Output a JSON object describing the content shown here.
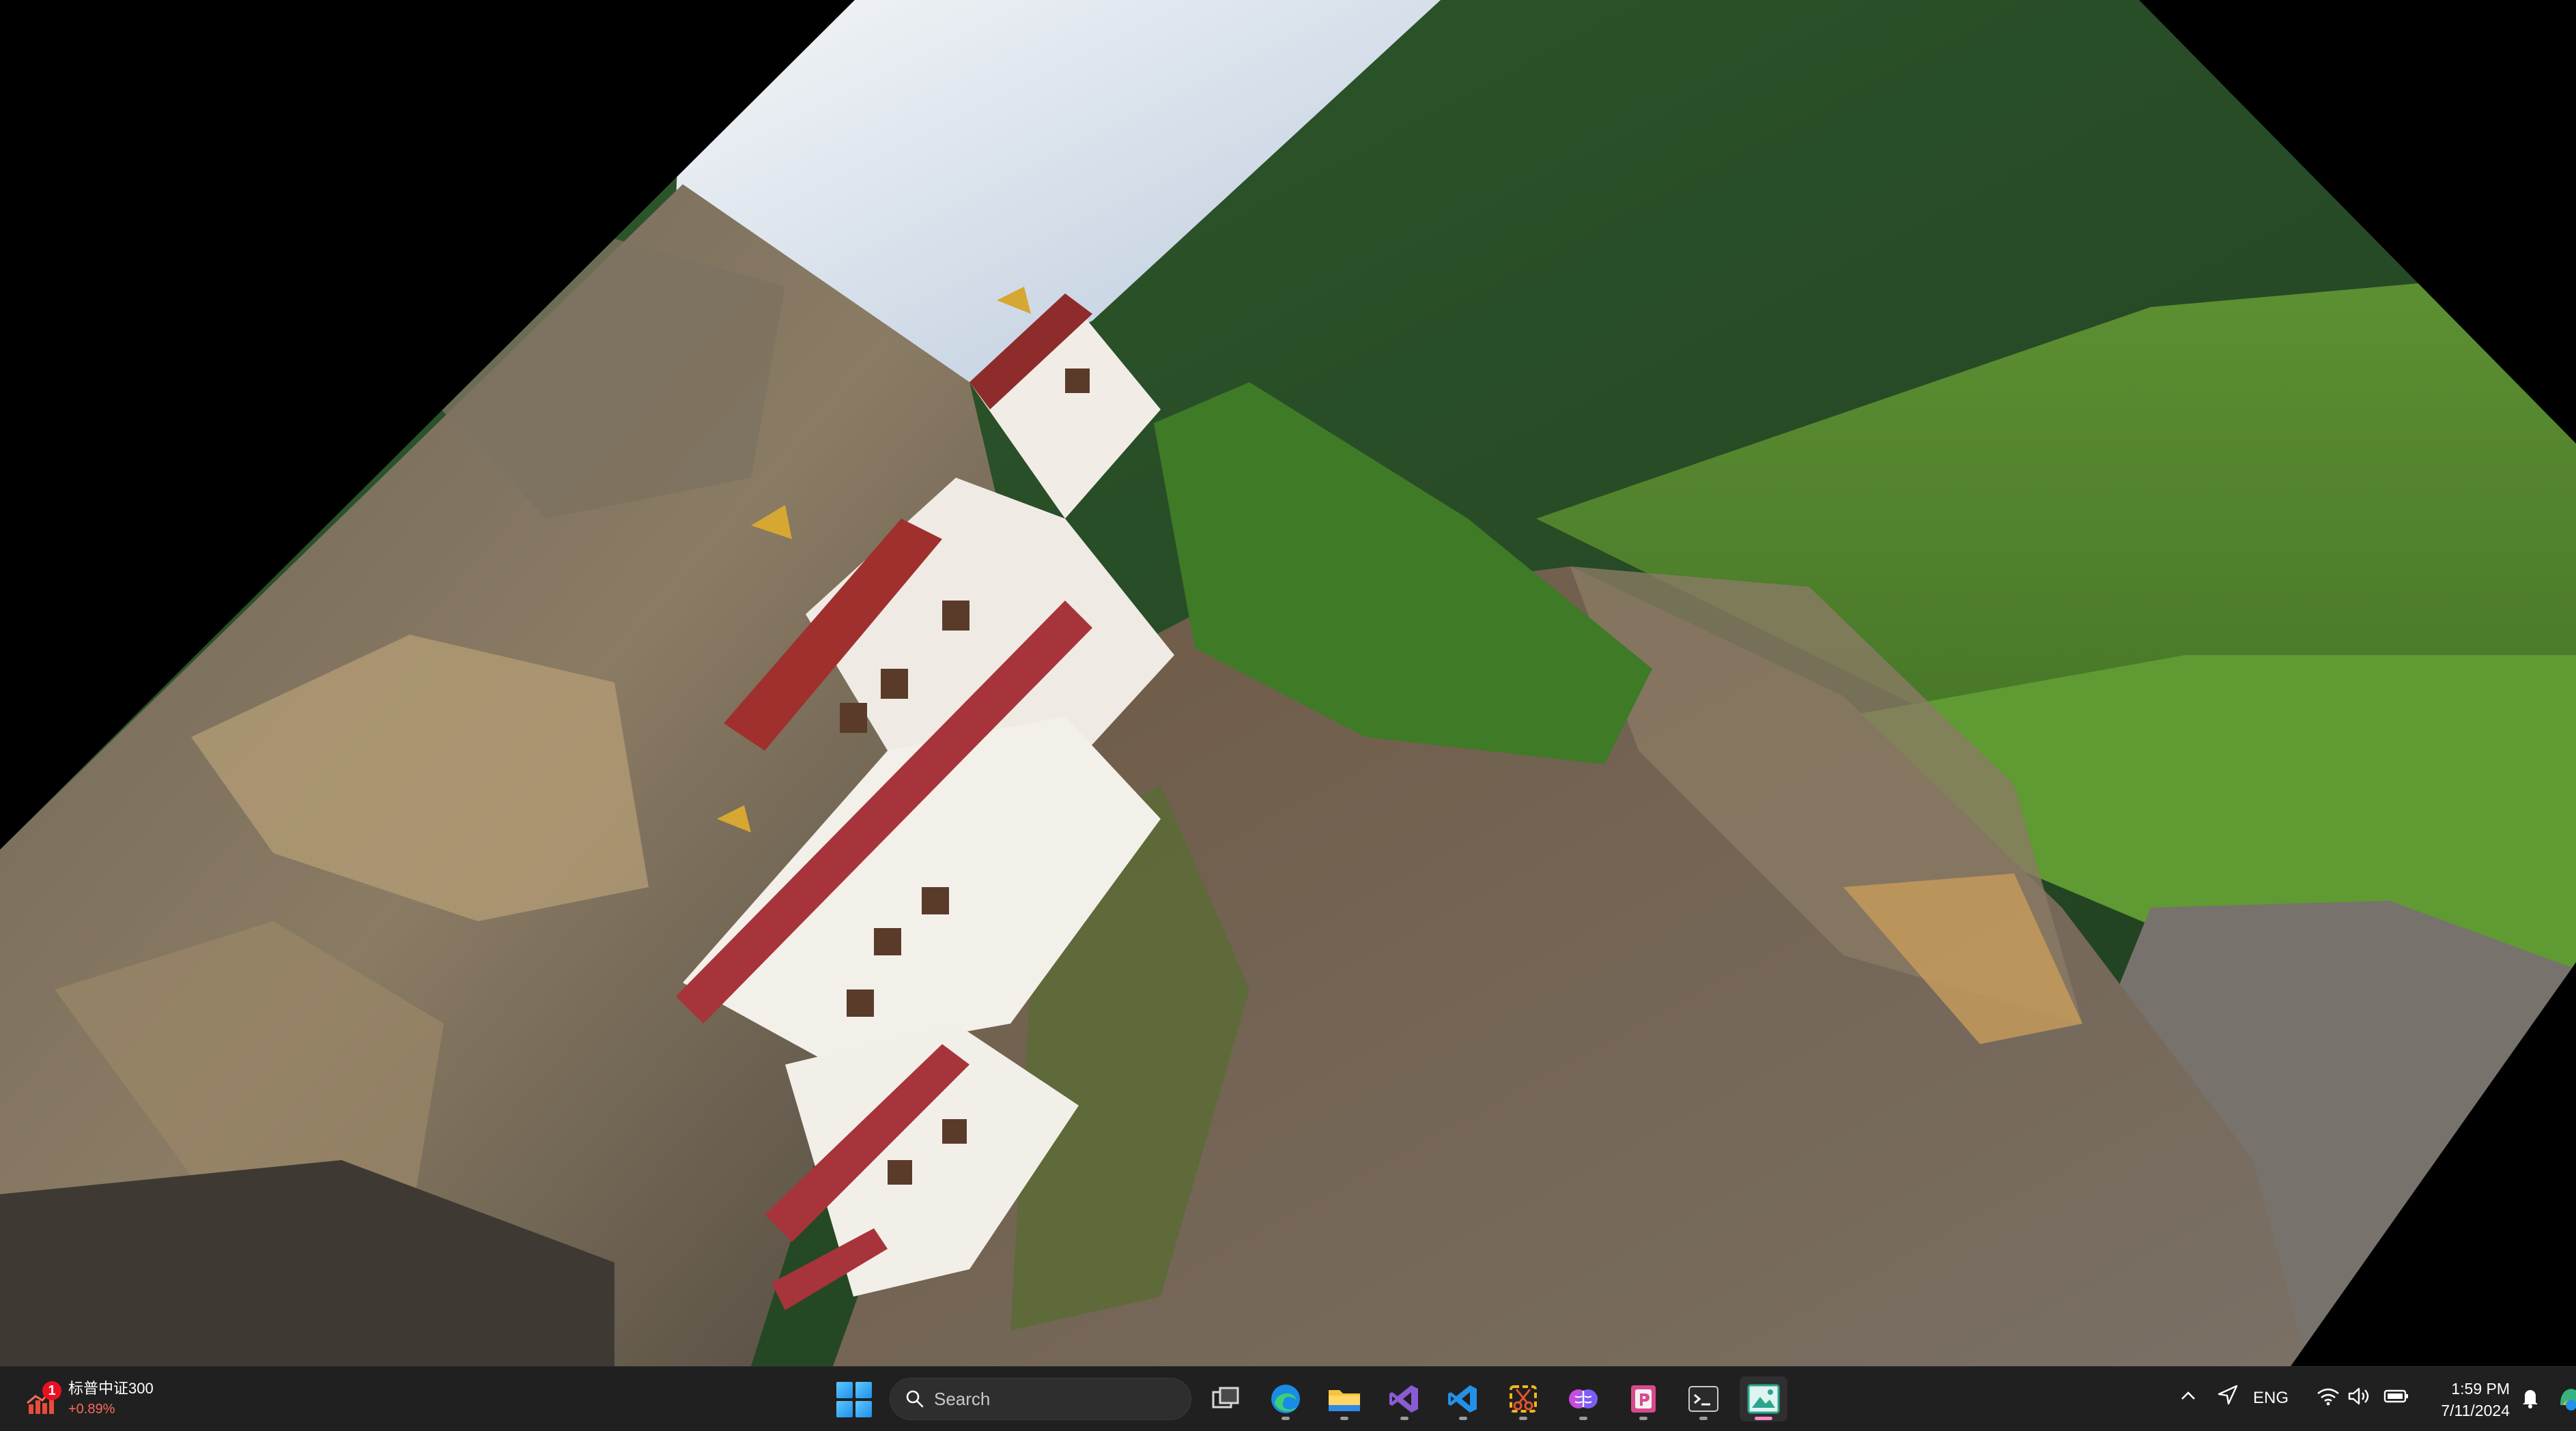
{
  "desktop": {
    "wallpaper": "Rotated photo of a cliffside monastery with forested mountains",
    "icons": []
  },
  "taskbar": {
    "widget": {
      "badge": "1",
      "title": "标普中证300",
      "change": "+0.89%",
      "icon": "stock-chart-icon",
      "change_color": "#ff6a5a"
    },
    "search": {
      "placeholder": "Search"
    },
    "apps": [
      {
        "name": "task-view",
        "icon": "task-view-icon",
        "running": false
      },
      {
        "name": "edge",
        "icon": "edge-icon",
        "running": true
      },
      {
        "name": "file-explorer",
        "icon": "folder-icon",
        "running": true
      },
      {
        "name": "visual-studio",
        "icon": "visual-studio-icon",
        "running": true
      },
      {
        "name": "vs-code",
        "icon": "vscode-icon",
        "running": true
      },
      {
        "name": "snipping-tool",
        "icon": "snipping-tool-icon",
        "running": true
      },
      {
        "name": "copilot-app",
        "icon": "brain-icon",
        "running": true
      },
      {
        "name": "powerpoint",
        "icon": "powerpoint-icon",
        "running": true
      },
      {
        "name": "terminal",
        "icon": "terminal-icon",
        "running": true
      },
      {
        "name": "image-viewer",
        "icon": "image-viewer-icon",
        "running": true,
        "active": true
      }
    ],
    "tray": {
      "language": "ENG",
      "time": "1:59 PM",
      "date": "7/11/2024"
    },
    "accent_color": "#ff88c8"
  }
}
